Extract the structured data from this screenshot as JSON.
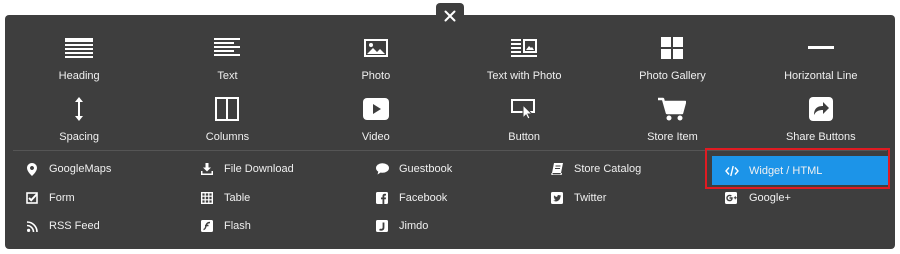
{
  "close": {
    "label": "×"
  },
  "big_items": [
    [
      {
        "label": "Heading",
        "icon": "heading-icon"
      },
      {
        "label": "Text",
        "icon": "text-icon"
      },
      {
        "label": "Photo",
        "icon": "photo-icon"
      },
      {
        "label": "Text with Photo",
        "icon": "text-with-photo-icon"
      },
      {
        "label": "Photo Gallery",
        "icon": "photo-gallery-icon"
      },
      {
        "label": "Horizontal Line",
        "icon": "horizontal-line-icon"
      }
    ],
    [
      {
        "label": "Spacing",
        "icon": "spacing-icon"
      },
      {
        "label": "Columns",
        "icon": "columns-icon"
      },
      {
        "label": "Video",
        "icon": "video-icon"
      },
      {
        "label": "Button",
        "icon": "button-icon"
      },
      {
        "label": "Store Item",
        "icon": "store-item-icon"
      },
      {
        "label": "Share Buttons",
        "icon": "share-buttons-icon"
      }
    ]
  ],
  "small_columns": [
    [
      {
        "label": "GoogleMaps",
        "icon": "map-pin-icon"
      },
      {
        "label": "Form",
        "icon": "form-checkbox-icon"
      },
      {
        "label": "RSS Feed",
        "icon": "rss-icon"
      }
    ],
    [
      {
        "label": "File Download",
        "icon": "download-icon"
      },
      {
        "label": "Table",
        "icon": "table-icon"
      },
      {
        "label": "Flash",
        "icon": "flash-icon"
      }
    ],
    [
      {
        "label": "Guestbook",
        "icon": "speech-bubble-icon"
      },
      {
        "label": "Facebook",
        "icon": "facebook-icon"
      },
      {
        "label": "Jimdo",
        "icon": "jimdo-icon"
      }
    ],
    [
      {
        "label": "Store Catalog",
        "icon": "catalog-icon"
      },
      {
        "label": "Twitter",
        "icon": "twitter-icon"
      }
    ],
    [
      {
        "label": "Widget / HTML",
        "icon": "code-icon",
        "selected": true
      },
      {
        "label": "Google+",
        "icon": "google-plus-icon"
      }
    ]
  ],
  "colors": {
    "panel": "#3e3e3e",
    "highlight": "#1c94e8",
    "outline": "#e01b22",
    "text": "#f0f0f0"
  }
}
